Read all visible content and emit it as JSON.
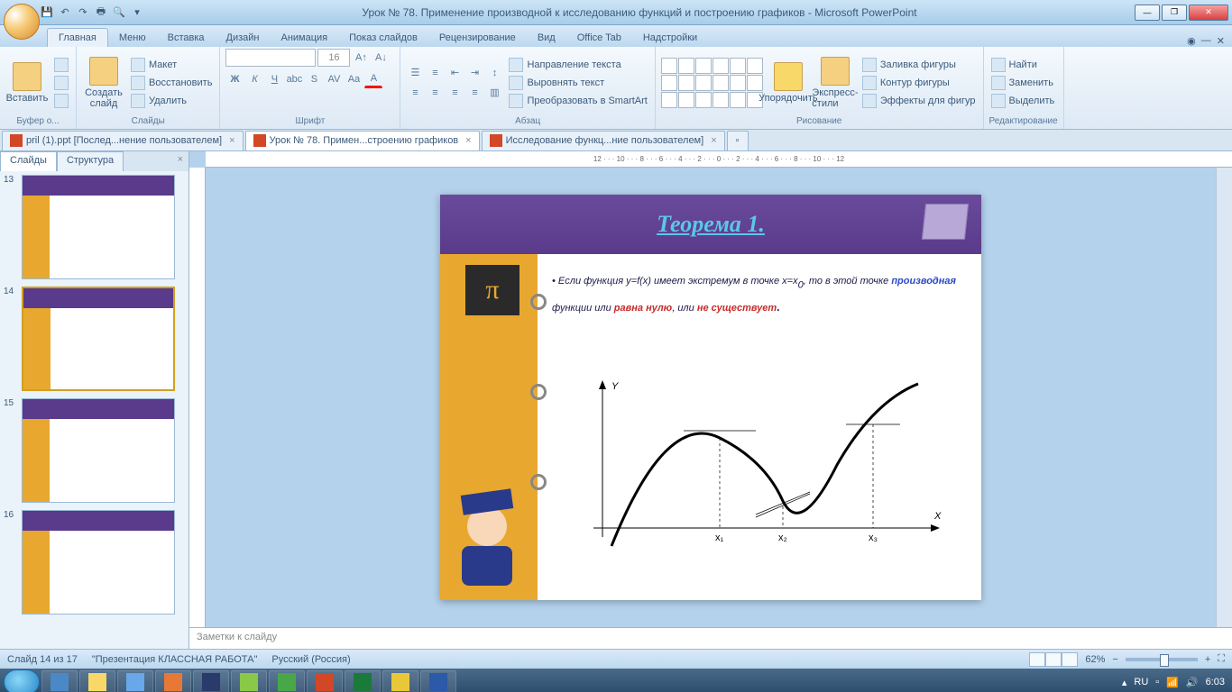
{
  "app": {
    "title": "Урок № 78. Применение производной к исследованию функций и построению графиков - Microsoft PowerPoint"
  },
  "ribbon_tabs": [
    "Главная",
    "Меню",
    "Вставка",
    "Дизайн",
    "Анимация",
    "Показ слайдов",
    "Рецензирование",
    "Вид",
    "Office Tab",
    "Надстройки"
  ],
  "ribbon": {
    "clipboard": {
      "paste": "Вставить",
      "label": "Буфер о..."
    },
    "slides": {
      "new": "Создать\nслайд",
      "layout": "Макет",
      "reset": "Восстановить",
      "delete": "Удалить",
      "label": "Слайды"
    },
    "font": {
      "size": "16",
      "label": "Шрифт"
    },
    "paragraph": {
      "dir": "Направление текста",
      "align": "Выровнять текст",
      "smart": "Преобразовать в SmartArt",
      "label": "Абзац"
    },
    "drawing": {
      "arrange": "Упорядочить",
      "quick": "Экспресс-стили",
      "fill": "Заливка фигуры",
      "outline": "Контур фигуры",
      "effects": "Эффекты для фигур",
      "label": "Рисование"
    },
    "editing": {
      "find": "Найти",
      "replace": "Заменить",
      "select": "Выделить",
      "label": "Редактирование"
    }
  },
  "doc_tabs": [
    {
      "label": "pril (1).ppt [Послед...нение пользователем]",
      "active": false
    },
    {
      "label": "Урок № 78. Примен...строению графиков",
      "active": true
    },
    {
      "label": "Исследование функц...ние пользователем]",
      "active": false
    }
  ],
  "slide_panel": {
    "tabs": [
      "Слайды",
      "Структура"
    ],
    "nums": [
      "13",
      "14",
      "15",
      "16"
    ],
    "selected": 1
  },
  "slide": {
    "title": "Теорема 1.",
    "text_prefix": "• Если функция y=f(x)  имеет экстремум в точке x=x",
    "text_sub": "0",
    "text_mid": ", то в этой точке ",
    "blue": "производная",
    "text_mid2": " функции или ",
    "red1": "равна нулю",
    "text_mid3": ", или ",
    "red2": "не существует",
    "axis_y": "Y",
    "axis_x": "X",
    "x1": "x₁",
    "x2": "x₂",
    "x3": "x₃"
  },
  "notes_placeholder": "Заметки к слайду",
  "status": {
    "slide": "Слайд 14 из 17",
    "theme": "\"Презентация КЛАССНАЯ РАБОТА\"",
    "lang": "Русский (Россия)",
    "zoom": "62%"
  },
  "tray": {
    "lang": "RU",
    "time": "6:03"
  },
  "ruler": "12 · · · 10 · · · 8 · · · 6 · · · 4 · · · 2 · · · 0 · · · 2 · · · 4 · · · 6 · · · 8 · · · 10 · · · 12"
}
